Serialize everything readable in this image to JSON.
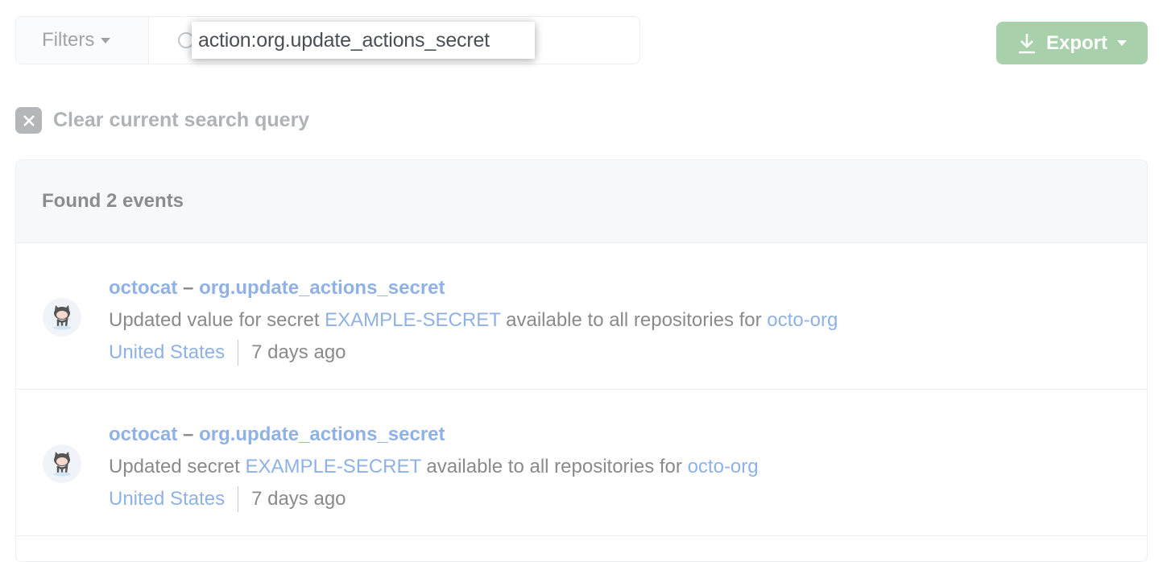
{
  "toolbar": {
    "filters_label": "Filters",
    "search_query": "action:org.update_actions_secret",
    "export_label": "Export"
  },
  "clear_label": "Clear current search query",
  "results": {
    "summary": "Found 2 events",
    "events": [
      {
        "actor": "octocat",
        "dash": "–",
        "action": "org.update_actions_secret",
        "desc_prefix": "Updated value for secret ",
        "secret": "EXAMPLE-SECRET",
        "desc_mid": " available to all repositories for ",
        "org": "octo-org",
        "location": "United States",
        "time": "7 days ago"
      },
      {
        "actor": "octocat",
        "dash": "–",
        "action": "org.update_actions_secret",
        "desc_prefix": "Updated secret ",
        "secret": "EXAMPLE-SECRET",
        "desc_mid": " available to all repositories for ",
        "org": "octo-org",
        "location": "United States",
        "time": "7 days ago"
      }
    ]
  },
  "colors": {
    "link": "#8fb1e6",
    "export_bg": "#a8d1ab",
    "text": "#8a8a8a"
  }
}
